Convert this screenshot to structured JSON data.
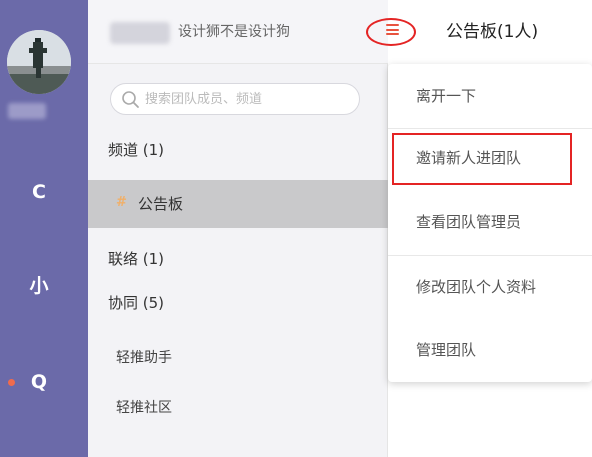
{
  "rail": {
    "items": [
      {
        "label": "C",
        "has_dot": false
      },
      {
        "label": "小",
        "has_dot": false
      },
      {
        "label": "Q",
        "has_dot": true
      }
    ]
  },
  "panel": {
    "team_name": "设计狮不是设计狗",
    "search": {
      "placeholder": "搜索团队成员、频道"
    },
    "channels_label": "频道 (1)",
    "channel_item": "公告板",
    "contacts_label": "联络 (1)",
    "collab_label": "协同 (5)",
    "collab_items": [
      "轻推助手",
      "轻推社区"
    ]
  },
  "header": {
    "board_title": "公告板(1人)"
  },
  "dropdown": {
    "items": [
      "离开一下",
      "邀请新人进团队",
      "查看团队管理员",
      "修改团队个人资料",
      "管理团队"
    ]
  },
  "colors": {
    "rail": "#6b6aa9",
    "highlight": "#e42424",
    "notification_dot": "#f06b4d"
  }
}
